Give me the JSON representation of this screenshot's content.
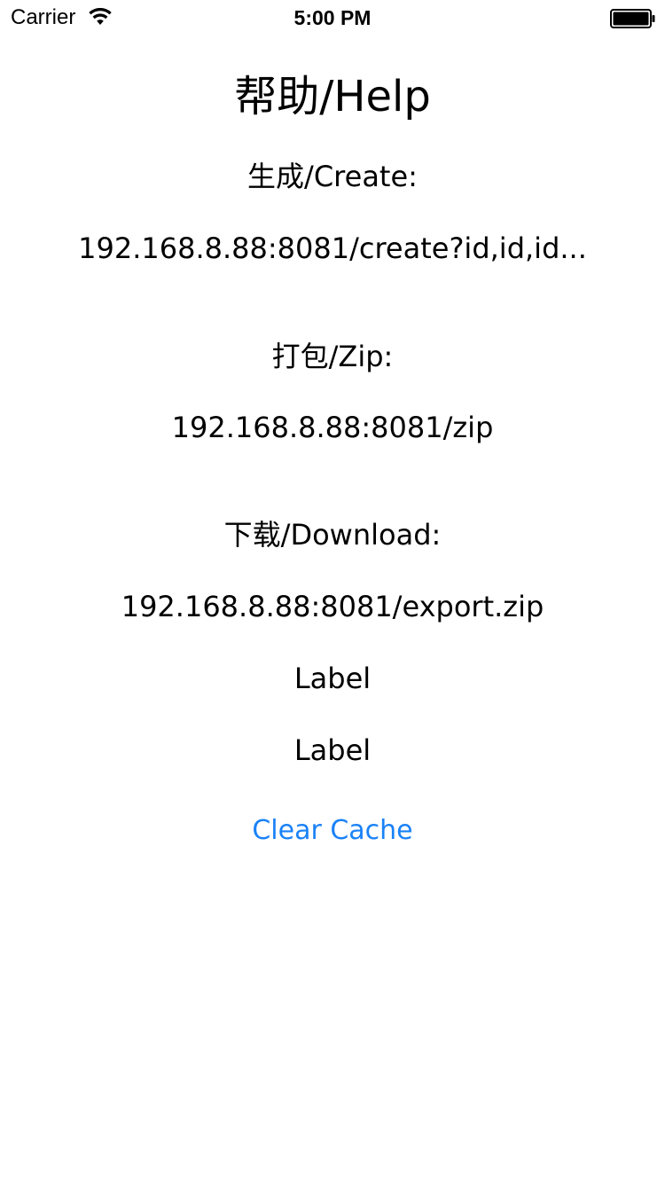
{
  "status_bar": {
    "carrier": "Carrier",
    "time": "5:00 PM",
    "wifi_icon": "wifi-icon",
    "battery_icon": "battery-full-icon"
  },
  "help": {
    "title": "帮助/Help",
    "create_label": "生成/Create:",
    "create_url": "192.168.8.88:8081/create?id,id,id...",
    "zip_label": "打包/Zip:",
    "zip_url": "192.168.8.88:8081/zip",
    "download_label": "下载/Download:",
    "download_url": "192.168.8.88:8081/export.zip",
    "label_1": "Label",
    "label_2": "Label",
    "clear_cache_label": "Clear Cache"
  },
  "colors": {
    "accent": "#1a82f7",
    "text": "#000000",
    "background": "#ffffff"
  }
}
